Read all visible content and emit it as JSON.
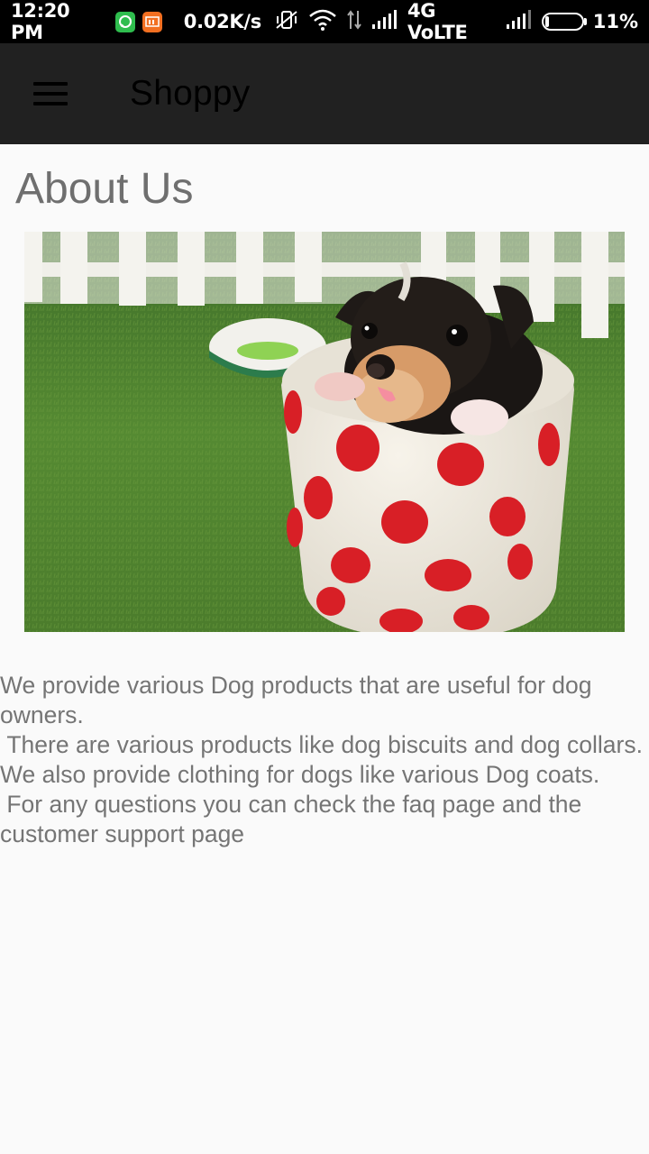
{
  "status_bar": {
    "time": "12:20 PM",
    "net_speed": "0.02K/s",
    "network": "4G VoLTE",
    "battery": "11%",
    "icons": [
      "whatsapp-icon",
      "mi-icon",
      "vibrate-off-icon",
      "wifi-icon",
      "data-arrows-icon",
      "signal-icon",
      "signal-icon-2",
      "battery-icon"
    ]
  },
  "app_bar": {
    "title": "Shoppy",
    "menu_icon": "hamburger-menu-icon",
    "background": "#212121"
  },
  "page": {
    "heading": "About Us",
    "image_subject": "puppy-in-polka-dot-cup",
    "body": "We provide various Dog products that are useful for dog owners.\n There are various products like dog biscuits and dog collars. We also provide clothing for dogs like various Dog coats.\n For any questions you can check the faq page and the customer support page"
  },
  "colors": {
    "status_bar": "#000000",
    "app_bar": "#212121",
    "background": "#fafafa",
    "text": "#757575"
  }
}
